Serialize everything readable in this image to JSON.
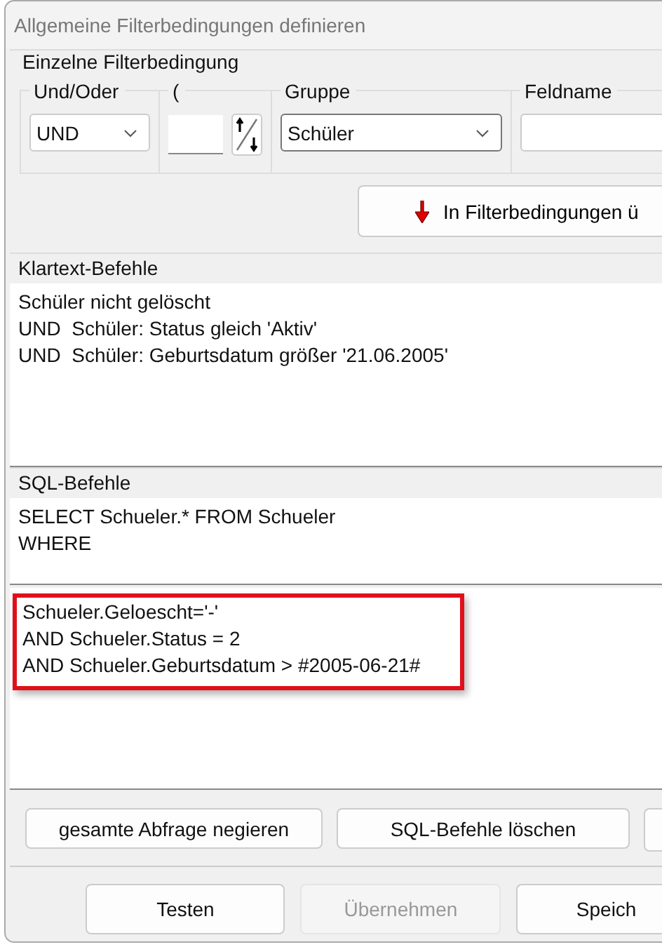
{
  "window": {
    "title": "Allgemeine Filterbedingungen definieren"
  },
  "filter": {
    "title": "Einzelne Filterbedingung",
    "logic": {
      "label": "Und/Oder",
      "value": "UND"
    },
    "bracket": {
      "label": "("
    },
    "group": {
      "label": "Gruppe",
      "value": "Schüler"
    },
    "field": {
      "label": "Feldname"
    },
    "add_button": "In Filterbedingungen ü"
  },
  "plain_text": {
    "title": "Klartext-Befehle",
    "lines": [
      "Schüler nicht gelöscht",
      "UND  Schüler: Status gleich 'Aktiv'",
      "UND  Schüler: Geburtsdatum größer '21.06.2005'"
    ]
  },
  "sql": {
    "title": "SQL-Befehle",
    "header_lines": [
      "SELECT Schueler.* FROM Schueler",
      "WHERE"
    ],
    "condition_lines": [
      "Schueler.Geloescht='-'",
      "AND Schueler.Status = 2",
      "AND Schueler.Geburtsdatum > #2005-06-21#"
    ]
  },
  "action_buttons": [
    "gesamte Abfrage negieren",
    "SQL-Befehle löschen"
  ],
  "dialog_buttons": [
    {
      "label": "Testen",
      "disabled": false
    },
    {
      "label": "Übernehmen",
      "disabled": true
    },
    {
      "label": "Speich",
      "disabled": false
    }
  ]
}
